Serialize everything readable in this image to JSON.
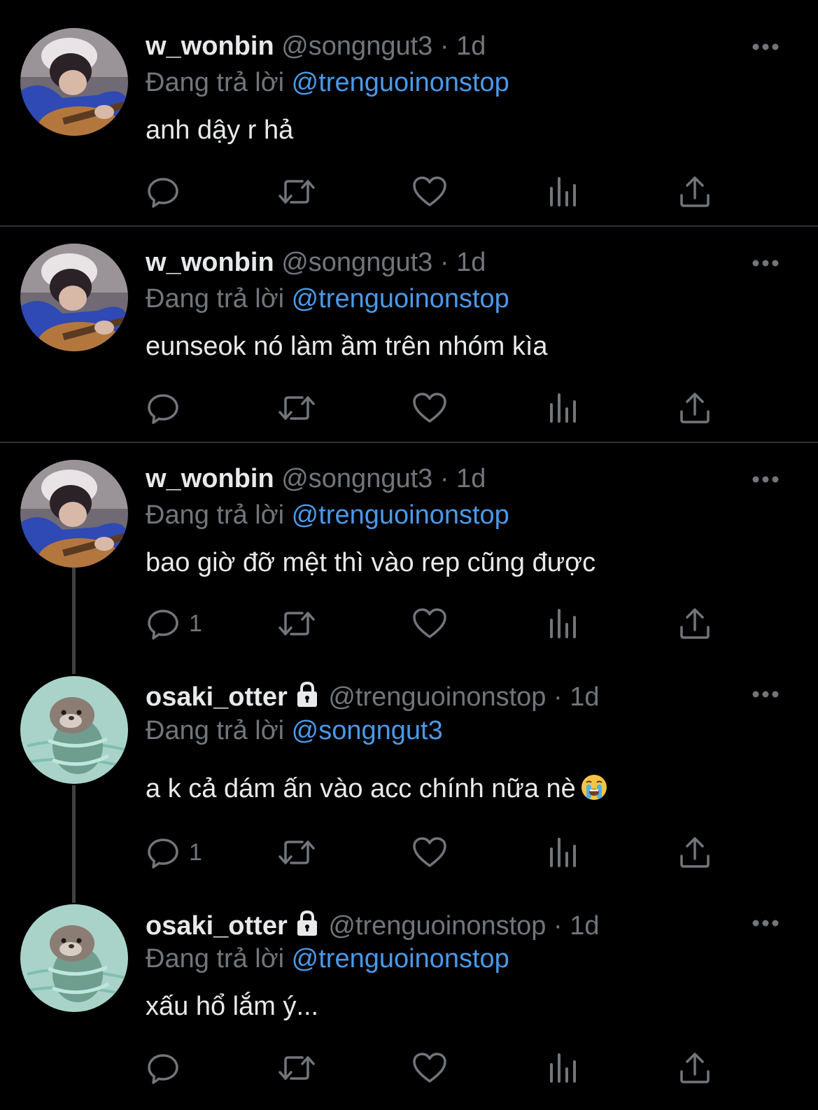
{
  "tweets": [
    {
      "name": "w_wonbin",
      "handle": "@songngut3",
      "time": "1d",
      "reply_prefix": "Đang trả lời",
      "reply_to": "@trenguoinonstop",
      "text": "anh dậy r hả",
      "reply_count": "",
      "avatar": "guitar",
      "locked": false
    },
    {
      "name": "w_wonbin",
      "handle": "@songngut3",
      "time": "1d",
      "reply_prefix": "Đang trả lời",
      "reply_to": "@trenguoinonstop",
      "text": "eunseok nó làm ầm trên nhóm kìa",
      "reply_count": "",
      "avatar": "guitar",
      "locked": false
    },
    {
      "name": "w_wonbin",
      "handle": "@songngut3",
      "time": "1d",
      "reply_prefix": "Đang trả lời",
      "reply_to": "@trenguoinonstop",
      "text": "bao giờ đỡ mệt thì vào rep cũng được",
      "reply_count": "1",
      "avatar": "guitar",
      "locked": false
    },
    {
      "name": "osaki_otter",
      "handle": "@trenguoinonstop",
      "time": "1d",
      "reply_prefix": "Đang trả lời",
      "reply_to": "@songngut3",
      "text": "a k cả dám ấn vào acc chính nữa nè",
      "text_emoji": "crying-face",
      "reply_count": "1",
      "avatar": "otter",
      "locked": true
    },
    {
      "name": "osaki_otter",
      "handle": "@trenguoinonstop",
      "time": "1d",
      "reply_prefix": "Đang trả lời",
      "reply_to": "@trenguoinonstop",
      "text": "xấu hổ lắm ý...",
      "reply_count": "",
      "avatar": "otter",
      "locked": true
    }
  ],
  "separator": "·",
  "icons": {
    "reply": "reply-icon",
    "retweet": "retweet-icon",
    "like": "heart-icon",
    "views": "analytics-icon",
    "share": "share-icon",
    "more": "more-icon",
    "lock": "lock-icon"
  },
  "colors": {
    "background": "#000000",
    "text": "#e7e9ea",
    "muted": "#71767b",
    "mention": "#4a99e9",
    "divider": "#2f3336"
  }
}
